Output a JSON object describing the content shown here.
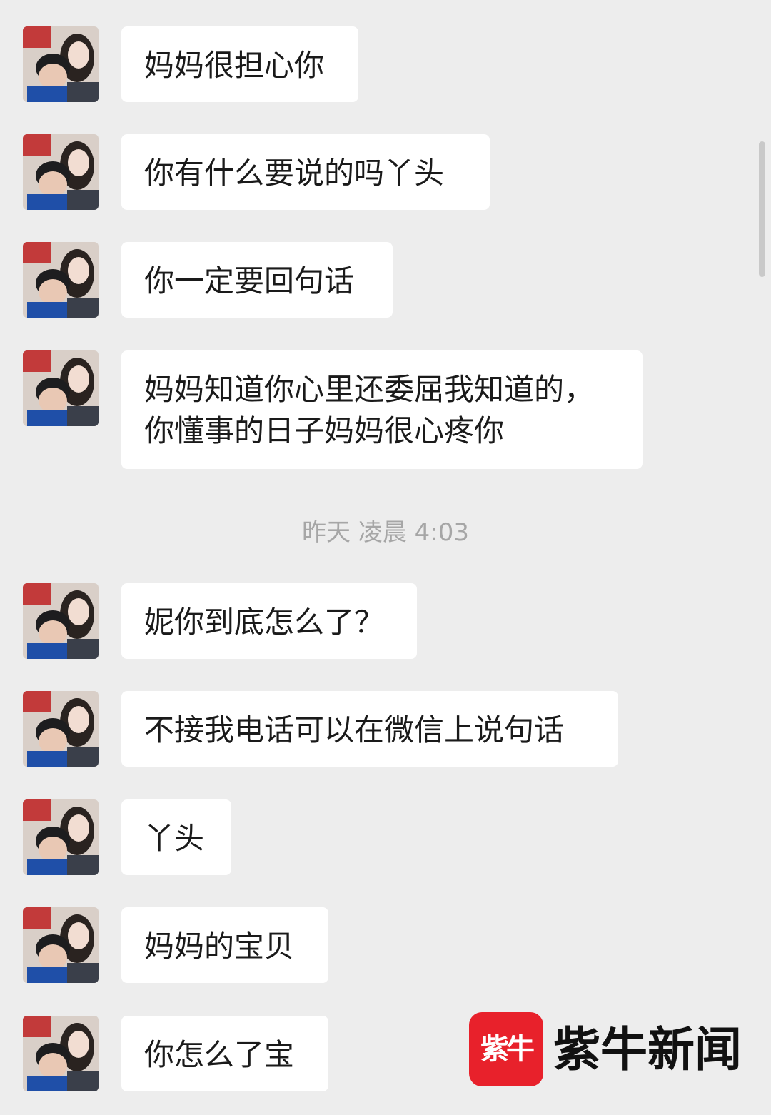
{
  "messages": [
    {
      "text": "妈妈很担心你"
    },
    {
      "text": "你有什么要说的吗丫头"
    },
    {
      "text": "你一定要回句话"
    },
    {
      "text": "妈妈知道你心里还委屈我知道的，",
      "text2": "你懂事的日子妈妈很心疼你"
    },
    {
      "text": "妮你到底怎么了？"
    },
    {
      "text": "不接我电话可以在微信上说句话"
    },
    {
      "text": "丫头"
    },
    {
      "text": "妈妈的宝贝"
    },
    {
      "text": "你怎么了宝"
    }
  ],
  "timestamp": "昨天 凌晨 4:03",
  "watermark": {
    "logo": "紫牛",
    "text": "紫牛新闻"
  },
  "colors": {
    "background": "#ededed",
    "bubble": "#ffffff",
    "watermark_red": "#e8212b"
  }
}
